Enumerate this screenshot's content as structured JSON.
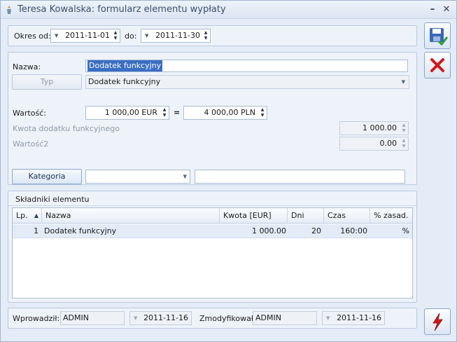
{
  "window": {
    "title": "Teresa Kowalska: formularz elementu wypłaty"
  },
  "period": {
    "from_label": "Okres od:",
    "from_value": "2011-11-01",
    "to_label": "do:",
    "to_value": "2011-11-30"
  },
  "form": {
    "name_label": "Nazwa:",
    "name_value": "Dodatek funkcyjny",
    "type_button": "Typ",
    "type_value": "Dodatek funkcyjny",
    "value_label": "Wartość:",
    "value_eur": "1 000,00 EUR",
    "equals": "=",
    "value_pln": "4 000,00 PLN",
    "kwota_label": "Kwota dodatku funkcyjnego",
    "kwota_value": "1 000.00",
    "wartosc2_label": "Wartość2",
    "wartosc2_value": "0.00",
    "category_button": "Kategoria",
    "category_value": "",
    "category_desc": ""
  },
  "components": {
    "section_title": "Składniki elementu",
    "headers": {
      "lp": "Lp.",
      "nazwa": "Nazwa",
      "kwota": "Kwota [EUR]",
      "dni": "Dni",
      "czas": "Czas",
      "zasad": "% zasad."
    },
    "rows": [
      {
        "lp": "1",
        "nazwa": "Dodatek funkcyjny",
        "kwota": "1 000.00",
        "dni": "20",
        "czas": "160:00",
        "zasad": "%"
      }
    ]
  },
  "footer": {
    "entered_label": "Wprowadził:",
    "entered_user": "ADMIN",
    "entered_date": "2011-11-16",
    "modified_label": "Zmodyfikował:",
    "modified_user": "ADMIN",
    "modified_date": "2011-11-16"
  },
  "icons": {
    "save": "save-icon",
    "cancel": "cancel-icon",
    "bolt": "lightning-icon",
    "accent_red": "#d01818",
    "accent_blue": "#2a5cb8"
  }
}
